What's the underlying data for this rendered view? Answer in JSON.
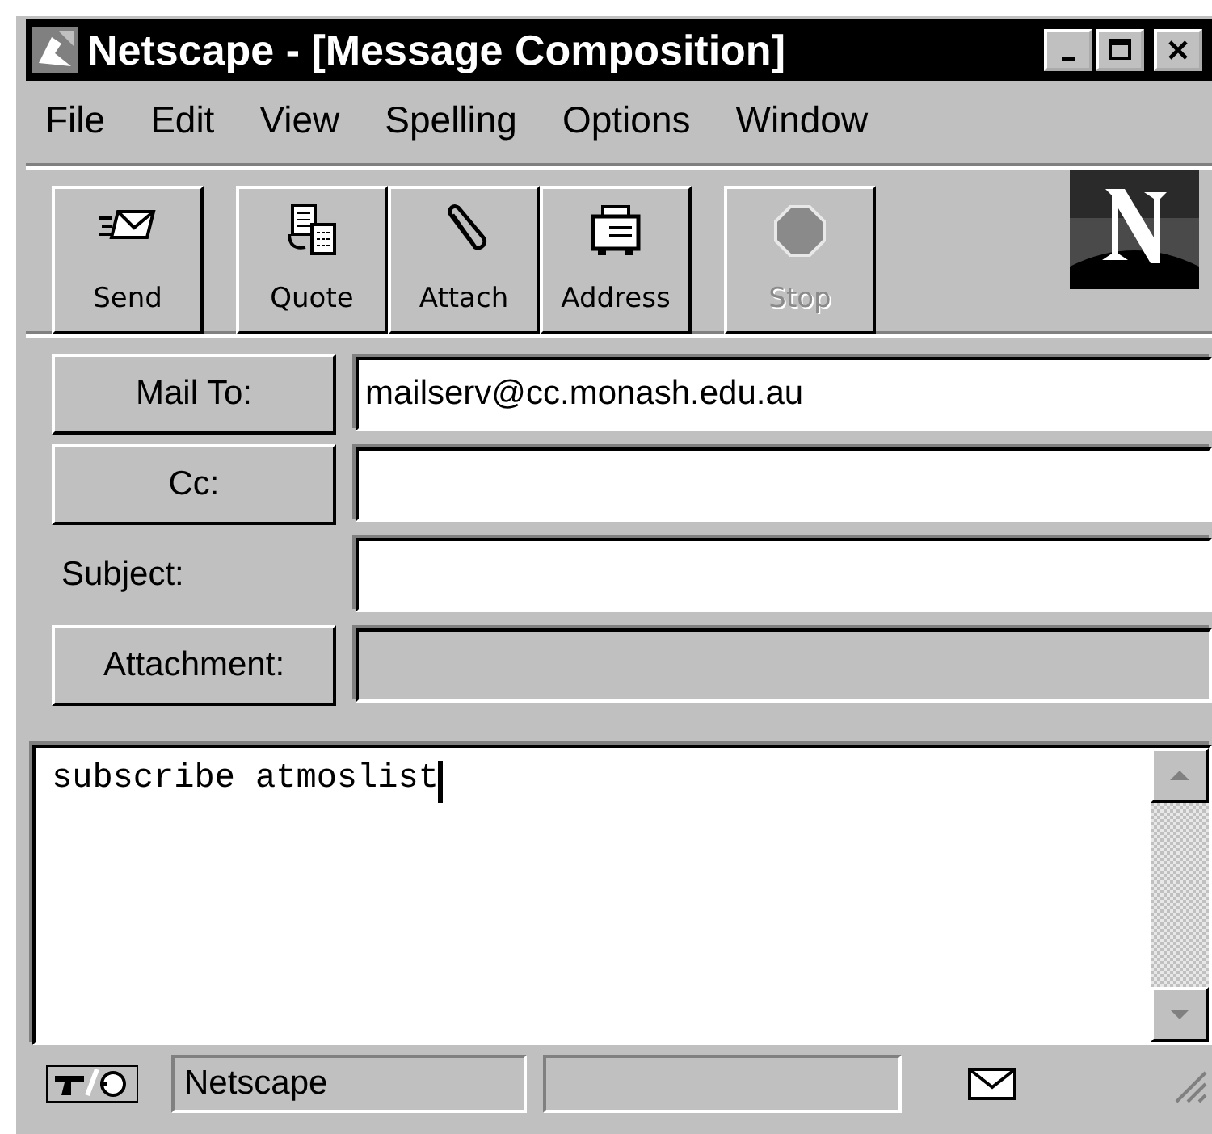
{
  "window": {
    "title": "Netscape - [Message Composition]"
  },
  "menu": [
    "File",
    "Edit",
    "View",
    "Spelling",
    "Options",
    "Window"
  ],
  "toolbar": {
    "groups": [
      {
        "buttons": [
          {
            "kind": "send",
            "label": "Send",
            "disabled": false
          }
        ]
      },
      {
        "buttons": [
          {
            "kind": "quote",
            "label": "Quote",
            "disabled": false
          },
          {
            "kind": "attach",
            "label": "Attach",
            "disabled": false
          },
          {
            "kind": "address",
            "label": "Address",
            "disabled": false
          }
        ]
      },
      {
        "buttons": [
          {
            "kind": "stop",
            "label": "Stop",
            "disabled": true
          }
        ]
      }
    ]
  },
  "fields": [
    {
      "kind": "button",
      "label": "Mail To:",
      "value": "mailserv@cc.monash.edu.au",
      "disabled": false
    },
    {
      "kind": "button",
      "label": "Cc:",
      "disabled": false
    },
    {
      "kind": "label",
      "label": "Subject:",
      "disabled": false
    },
    {
      "kind": "button",
      "label": "Attachment:",
      "disabled": true
    }
  ],
  "body": {
    "text": "subscribe atmoslist"
  },
  "status_bar": {
    "message": "Netscape"
  }
}
